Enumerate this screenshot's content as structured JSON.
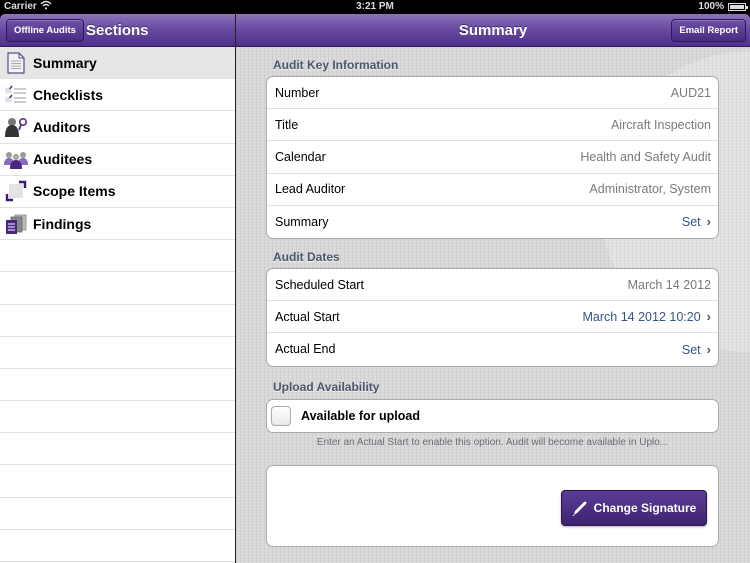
{
  "status_bar": {
    "carrier": "Carrier",
    "time": "3:21 PM",
    "battery": "100%",
    "wifi_icon": "wifi-icon",
    "battery_icon": "battery-icon"
  },
  "left_nav": {
    "back_button": "Offline Audits",
    "title": "Sections"
  },
  "right_nav": {
    "title": "Summary",
    "action_button": "Email Report"
  },
  "sidebar": {
    "selected": "Summary",
    "items": [
      {
        "label": "Summary",
        "icon": "document-icon"
      },
      {
        "label": "Checklists",
        "icon": "checklist-icon"
      },
      {
        "label": "Auditors",
        "icon": "auditor-icon"
      },
      {
        "label": "Auditees",
        "icon": "group-icon"
      },
      {
        "label": "Scope Items",
        "icon": "scope-icon"
      },
      {
        "label": "Findings",
        "icon": "clipboard-icon"
      }
    ]
  },
  "sections": {
    "key_info": {
      "header": "Audit Key Information",
      "rows": [
        {
          "label": "Number",
          "value": "AUD21"
        },
        {
          "label": "Title",
          "value": "Aircraft Inspection"
        },
        {
          "label": "Calendar",
          "value": "Health and Safety Audit"
        },
        {
          "label": "Lead Auditor",
          "value": "Administrator, System"
        },
        {
          "label": "Summary",
          "value": "Set"
        }
      ]
    },
    "dates": {
      "header": "Audit Dates",
      "rows": [
        {
          "label": "Scheduled Start",
          "value": "March 14 2012"
        },
        {
          "label": "Actual Start",
          "value": "March 14 2012 10:20"
        },
        {
          "label": "Actual End",
          "value": "Set"
        }
      ]
    },
    "upload": {
      "header": "Upload Availability",
      "checkbox_label": "Available for upload",
      "checked": false,
      "footnote": "Enter an Actual Start to enable this option. Audit will become available in Uplo..."
    },
    "signature": {
      "button": "Change Signature",
      "icon": "pen-icon"
    }
  },
  "colors": {
    "brand_purple": "#5c3c97",
    "link_blue": "#385487",
    "section_header": "#4c566c"
  }
}
